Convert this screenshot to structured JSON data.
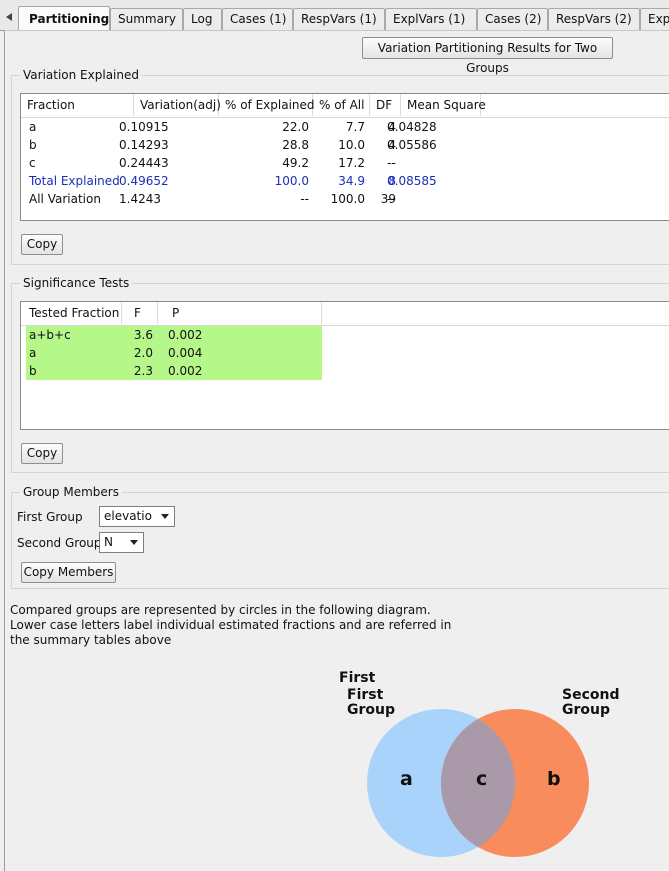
{
  "tabs": [
    {
      "label": "Partitioning",
      "active": true
    },
    {
      "label": "Summary"
    },
    {
      "label": "Log"
    },
    {
      "label": "Cases (1)"
    },
    {
      "label": "RespVars (1)"
    },
    {
      "label": "ExplVars (1)"
    },
    {
      "label": "Cases (2)"
    },
    {
      "label": "RespVars (2)"
    },
    {
      "label": "Expl"
    }
  ],
  "results_button": "Variation Partitioning Results for Two Groups",
  "variation": {
    "title": "Variation Explained",
    "columns": [
      "Fraction",
      "Variation(adj)",
      "% of Explained",
      "% of All",
      "DF",
      "Mean Square"
    ],
    "rows": [
      {
        "fraction": "a",
        "variation": "0.10915",
        "pct_explained": "22.0",
        "pct_all": "7.7",
        "df": "4",
        "mean_square": "0.04828",
        "highlight": false
      },
      {
        "fraction": "b",
        "variation": "0.14293",
        "pct_explained": "28.8",
        "pct_all": "10.0",
        "df": "4",
        "mean_square": "0.05586",
        "highlight": false
      },
      {
        "fraction": "c",
        "variation": "0.24443",
        "pct_explained": "49.2",
        "pct_all": "17.2",
        "df": "--",
        "mean_square": "--",
        "highlight": false
      },
      {
        "fraction": "Total Explained",
        "variation": "0.49652",
        "pct_explained": "100.0",
        "pct_all": "34.9",
        "df": "8",
        "mean_square": "0.08585",
        "highlight": true
      },
      {
        "fraction": "All Variation",
        "variation": "1.4243",
        "pct_explained": "--",
        "pct_all": "100.0",
        "df": "39",
        "mean_square": "--",
        "highlight": false
      }
    ],
    "copy_label": "Copy",
    "highlight_color": "#1b2fb6"
  },
  "significance": {
    "title": "Significance Tests",
    "columns": [
      "Tested Fraction",
      "F",
      "P"
    ],
    "rows": [
      {
        "fraction": "a+b+c",
        "f": "3.6",
        "p": "0.002"
      },
      {
        "fraction": "a",
        "f": "2.0",
        "p": "0.004"
      },
      {
        "fraction": "b",
        "f": "2.3",
        "p": "0.002"
      }
    ],
    "row_color": "#b6f78a",
    "copy_label": "Copy"
  },
  "groups": {
    "title": "Group Members",
    "first_label": "First Group",
    "first_value": "elevatio",
    "second_label": "Second Group",
    "second_value": "N",
    "copy_members_label": "Copy Members"
  },
  "note_lines": [
    "Compared groups are represented by circles in the following diagram.",
    "Lower case letters label individual estimated fractions and are referred in",
    "the summary tables above"
  ],
  "diagram": {
    "first_title_lines": [
      "First",
      "First",
      "Group"
    ],
    "second_title_lines": [
      "Second",
      "Group"
    ],
    "letter_a": "a",
    "letter_b": "b",
    "letter_c": "c",
    "first_color": "#a9d3fb",
    "second_color": "#f98c5d",
    "overlap_color": "#aa9aa9"
  }
}
